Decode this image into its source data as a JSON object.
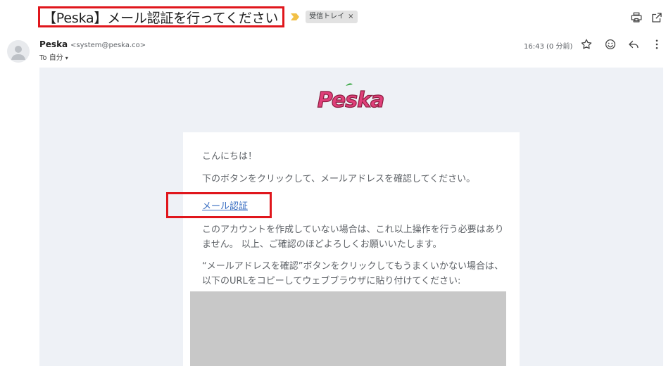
{
  "subject": "【Peska】メール認証を行ってください",
  "label": {
    "name": "受信トレイ",
    "close": "×"
  },
  "sender": {
    "name": "Peska",
    "email": "<system@peska.co>"
  },
  "recipient": {
    "prefix": "To",
    "name": "自分",
    "caret": "▾"
  },
  "time": "16:43 (0 分前)",
  "logo": {
    "text": "Peska",
    "colors": {
      "primary": "#e0407a",
      "leaf": "#3aa845",
      "outline": "#8a1d3f"
    }
  },
  "body": {
    "greeting": "こんにちは！",
    "instruction": "下のボタンをクリックして、メールアドレスを確認してください。",
    "verify_link": "メール認証",
    "note1": "このアカウントを作成していない場合は、これ以上操作を行う必要はありません。 以上、ご確認のほどよろしくお願いいたします。",
    "note2": "“メールアドレスを確認”ボタンをクリックしてもうまくいかない場合は、以下のURLをコピーしてウェブブラウザに貼り付けてください:"
  },
  "icons": {
    "print": "print-icon",
    "open_new": "open-in-new-icon",
    "star": "star-icon",
    "emoji": "emoji-icon",
    "reply": "reply-icon",
    "more": "more-vert-icon",
    "avatar": "person-icon",
    "importance": "importance-marker-icon"
  },
  "colors": {
    "highlight": "#e0161c",
    "link": "#3b6fc2",
    "body_bg": "#eef1f6"
  }
}
